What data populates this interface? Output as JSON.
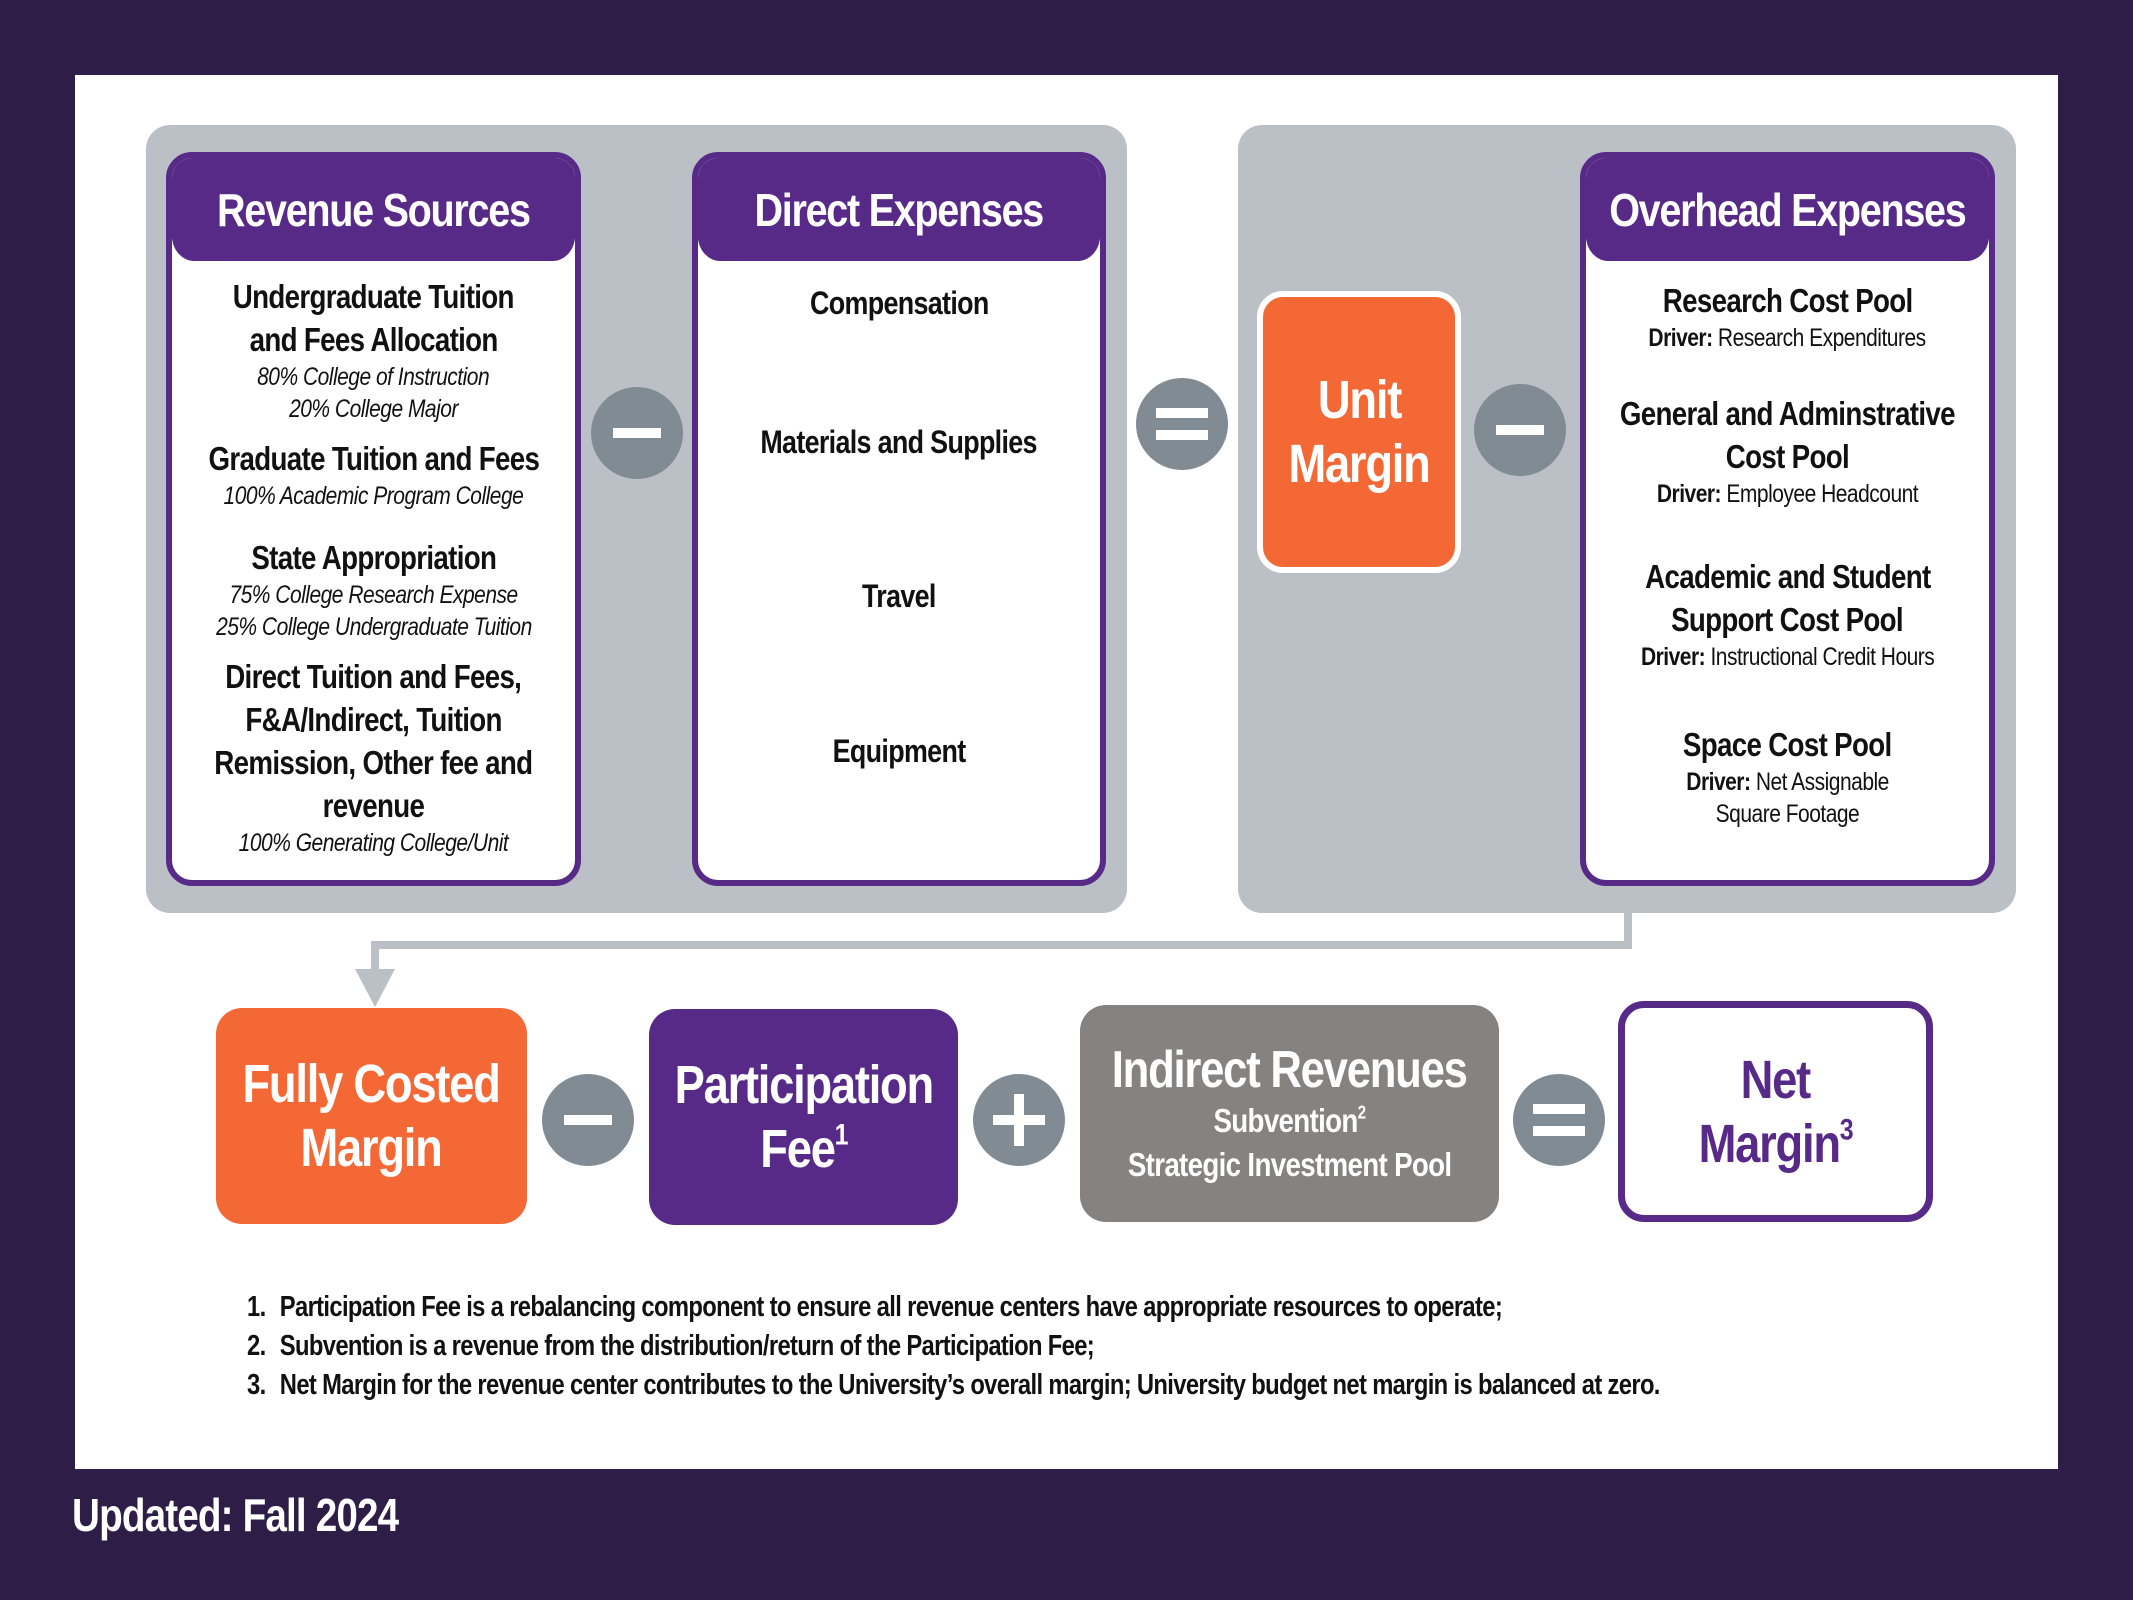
{
  "revenue_sources": {
    "title": "Revenue Sources",
    "items": [
      {
        "title_lines": [
          "Undergraduate Tuition",
          "and Fees Allocation"
        ],
        "notes": [
          "80% College of Instruction",
          "20% College Major"
        ]
      },
      {
        "title_lines": [
          "Graduate Tuition and Fees"
        ],
        "notes": [
          "100% Academic Program College"
        ]
      },
      {
        "title_lines": [
          "State Appropriation"
        ],
        "notes": [
          "75% College Research Expense",
          "25% College Undergraduate Tuition"
        ]
      },
      {
        "title_lines": [
          "Direct Tuition and Fees,",
          "F&A/Indirect, Tuition",
          "Remission, Other fee and",
          "revenue"
        ],
        "notes": [
          "100% Generating College/Unit"
        ]
      }
    ]
  },
  "operators": {
    "minus_1": "minus-icon",
    "equals_1": "equals-icon",
    "minus_2": "minus-icon",
    "minus_3": "minus-icon",
    "plus_1": "plus-icon",
    "equals_2": "equals-icon"
  },
  "direct_expenses": {
    "title": "Direct Expenses",
    "items": [
      "Compensation",
      "Materials and Supplies",
      "Travel",
      "Equipment"
    ]
  },
  "unit_margin": {
    "lines": [
      "Unit",
      "Margin"
    ]
  },
  "overhead_expenses": {
    "title": "Overhead Expenses",
    "driver_label": "Driver:",
    "items": [
      {
        "title_lines": [
          "Research Cost Pool"
        ],
        "driver_lines": [
          "Research Expenditures"
        ]
      },
      {
        "title_lines": [
          "General and Adminstrative",
          "Cost Pool"
        ],
        "driver_lines": [
          "Employee Headcount"
        ]
      },
      {
        "title_lines": [
          "Academic and Student",
          "Support Cost Pool"
        ],
        "driver_lines": [
          "Instructional Credit Hours"
        ]
      },
      {
        "title_lines": [
          "Space Cost Pool"
        ],
        "driver_lines": [
          "Net Assignable",
          "Square Footage"
        ]
      }
    ]
  },
  "bottom_row": {
    "fully_costed": {
      "lines": [
        "Fully Costed",
        "Margin"
      ]
    },
    "participation_fee": {
      "line1": "Participation",
      "line2": "Fee",
      "sup": "1"
    },
    "indirect_revenues": {
      "title": "Indirect Revenues",
      "sub1": "Subvention",
      "sub1_sup": "2",
      "sub2": "Strategic Investment Pool"
    },
    "net_margin": {
      "line1": "Net",
      "line2": "Margin",
      "sup": "3"
    }
  },
  "footnotes": [
    {
      "num": "1.",
      "text": "Participation Fee is a rebalancing component to ensure all revenue centers have appropriate resources to operate;"
    },
    {
      "num": "2.",
      "text": "Subvention is a revenue from the distribution/return of the Participation Fee;"
    },
    {
      "num": "3.",
      "text": "Net Margin for the revenue center contributes to the University’s overall margin; University budget net margin is balanced at zero."
    }
  ],
  "updated": "Updated: Fall 2024",
  "colors": {
    "background": "#2e1d47",
    "purple": "#572a88",
    "orange": "#f46835",
    "gray_box": "#858280",
    "group_gray": "#bbbfc6",
    "operator_gray": "#818b94"
  }
}
